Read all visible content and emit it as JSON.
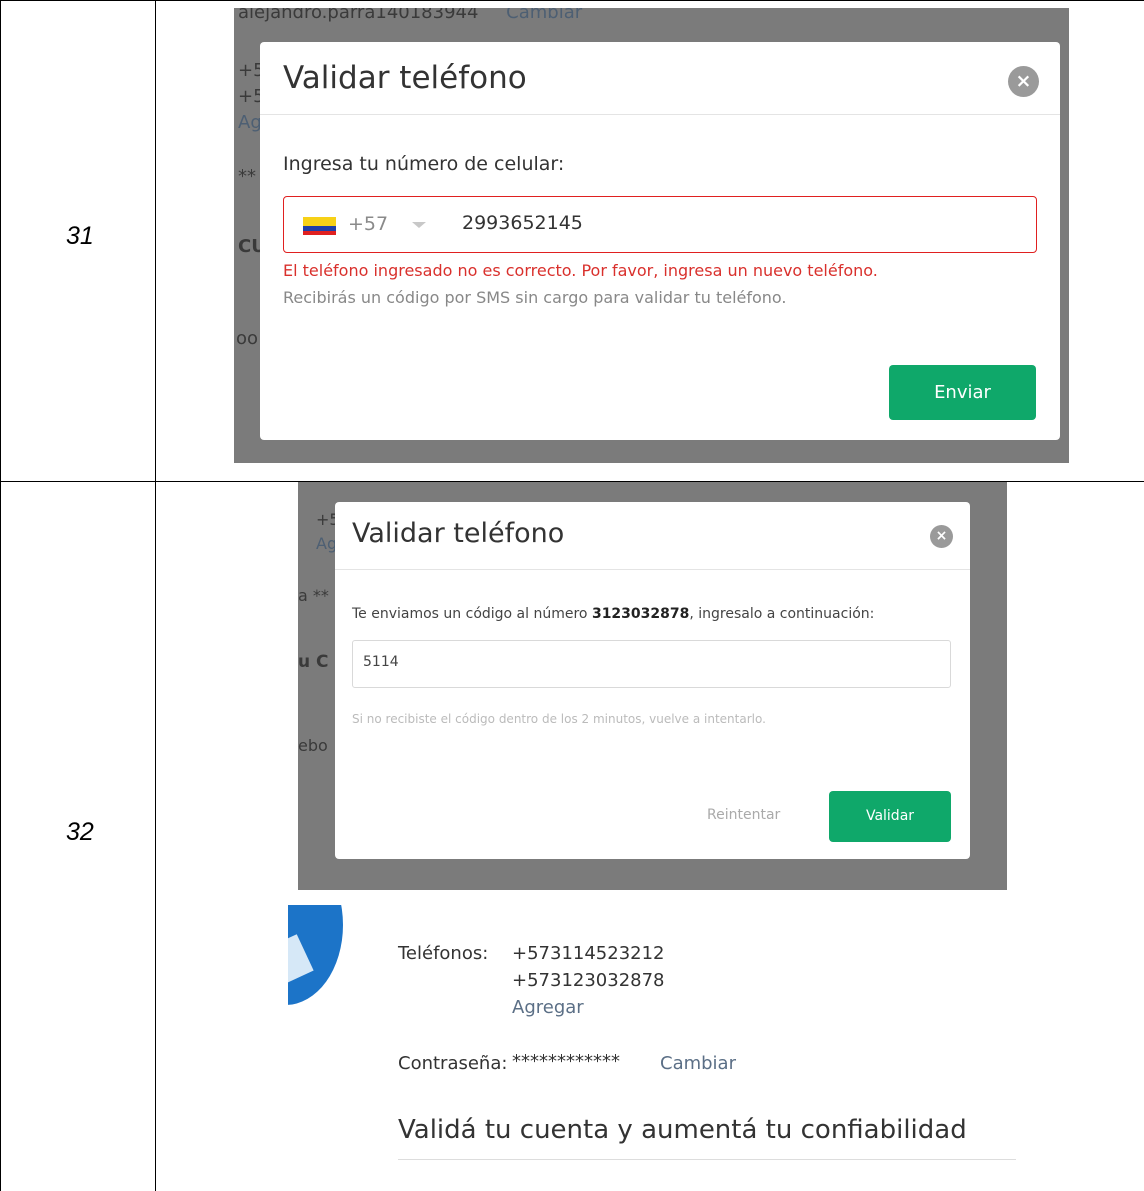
{
  "rows": [
    {
      "number": "31"
    },
    {
      "number": "32"
    }
  ],
  "screenshot_1": {
    "background": {
      "username": "alejandro.parra140183944",
      "change_link": "Cambiar",
      "frag_phone_a": "+5",
      "frag_phone_b": "+5",
      "frag_add": "Ag",
      "frag_pass": "**",
      "frag_section": "CU",
      "frag_facebook": "oo"
    },
    "modal": {
      "title": "Validar teléfono",
      "close_icon": "×",
      "label": "Ingresa tu número de celular:",
      "country_code": "+57",
      "phone_value": "2993652145",
      "error": "El teléfono ingresado no es correcto. Por favor, ingresa un nuevo teléfono.",
      "hint": "Recibirás un código por SMS sin cargo para validar tu teléfono.",
      "submit": "Enviar"
    }
  },
  "screenshot_2": {
    "background": {
      "frag_phone": "+5",
      "frag_add": "Ag",
      "frag_pass": "a **",
      "frag_section": "u C",
      "frag_facebook": "ebo"
    },
    "modal": {
      "title": "Validar teléfono",
      "close_icon": "×",
      "sent_prefix": "Te enviamos un código al número ",
      "sent_number": "3123032878",
      "sent_suffix": ", ingresalo a continuación:",
      "code_value": "5114",
      "hint": "Si no recibiste el código dentro de los 2 minutos, vuelve a intentarlo.",
      "retry": "Reintentar",
      "validate": "Validar"
    }
  },
  "profile": {
    "phones_label": "Teléfonos:",
    "phones": [
      "+573114523212",
      "+573123032878"
    ],
    "add_link": "Agregar",
    "password_label": "Contraseña:",
    "password_value": "************",
    "change_link": "Cambiar",
    "section_heading": "Validá tu cuenta y aumentá tu confiabilidad"
  },
  "colors": {
    "accent_green": "#0fa86a",
    "error_red": "#d9302c",
    "overlay_gray": "#7b7b7b"
  }
}
